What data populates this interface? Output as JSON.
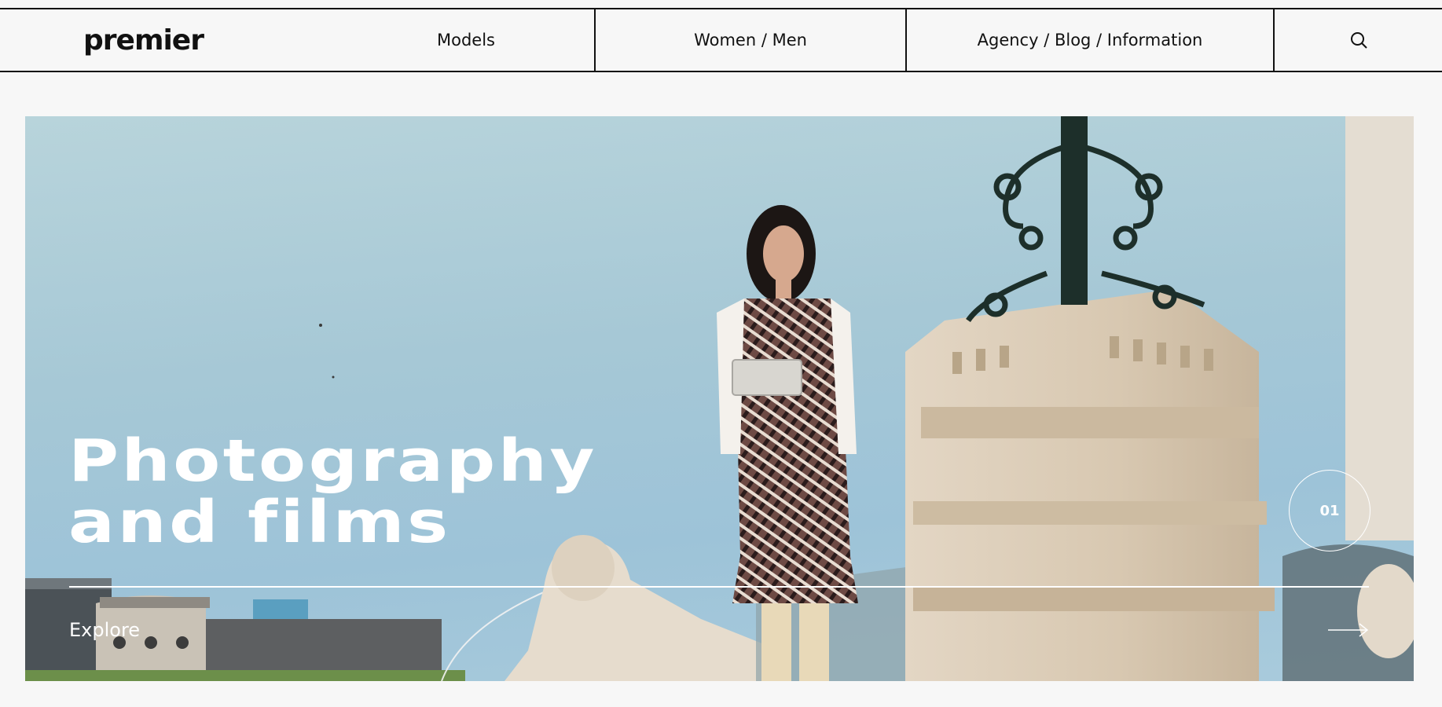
{
  "header": {
    "logo": "premier",
    "nav": {
      "models": "Models",
      "gender": "Women / Men",
      "agency": "Agency / Blog / Information"
    },
    "search_icon": "search-icon"
  },
  "hero": {
    "title_line1": "Photography",
    "title_line2": "and films",
    "cta_label": "Explore",
    "cta_icon": "arrow-right-icon",
    "slide_number": "01"
  },
  "colors": {
    "background": "#f7f7f7",
    "text": "#111111",
    "hero_text": "#ffffff",
    "sky": "#a6c8d6"
  }
}
